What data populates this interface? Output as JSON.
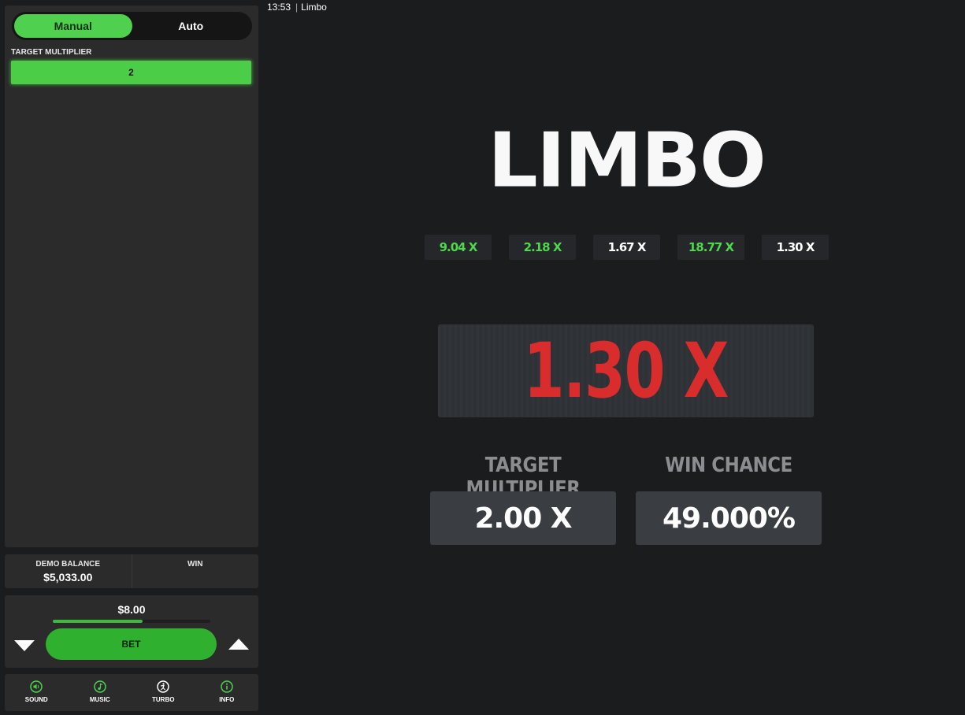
{
  "topbar": {
    "time": "13:53",
    "title": "Limbo"
  },
  "modes": {
    "manual": "Manual",
    "auto": "Auto",
    "active": "manual"
  },
  "target": {
    "label": "TARGET MULTIPLIER",
    "value": "2"
  },
  "balance": {
    "demo_label": "DEMO BALANCE",
    "demo_value": "$5,033.00",
    "win_label": "WIN",
    "win_value": ""
  },
  "bet": {
    "amount": "$8.00",
    "slider_fraction": 0.57,
    "button_label": "BET"
  },
  "footer": [
    {
      "label": "SOUND",
      "icon": "sound-icon"
    },
    {
      "label": "MUSIC",
      "icon": "music-icon"
    },
    {
      "label": "TURBO",
      "icon": "turbo-icon"
    },
    {
      "label": "INFO",
      "icon": "info-icon"
    }
  ],
  "game": {
    "logo": "LIMBO",
    "history": [
      {
        "value": "9.04 X",
        "color": "#4cd94a"
      },
      {
        "value": "2.18 X",
        "color": "#4cd94a"
      },
      {
        "value": "1.67 X",
        "color": "#ffffff"
      },
      {
        "value": "18.77 X",
        "color": "#4cd94a"
      },
      {
        "value": "1.30 X",
        "color": "#ffffff"
      }
    ],
    "result": "1.30 X",
    "result_color": "#d92d2d",
    "target_label": "TARGET MULTIPLIER",
    "target_value": "2.00 X",
    "chance_label": "WIN CHANCE",
    "chance_value": "49.000%"
  },
  "colors": {
    "accent": "#4fd04f",
    "button": "#2fb12f",
    "panel": "#2b2b2b",
    "background": "#1b1c1e"
  }
}
